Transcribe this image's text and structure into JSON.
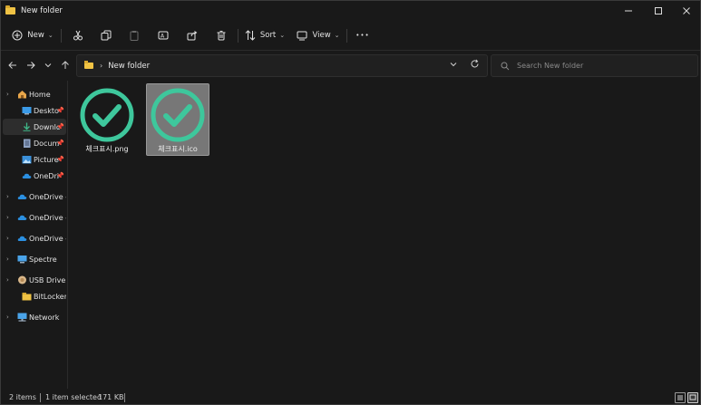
{
  "window": {
    "title": "New folder"
  },
  "commandbar": {
    "new_label": "New",
    "sort_label": "Sort",
    "view_label": "View",
    "more_label": "•••"
  },
  "address": {
    "crumb": "New folder",
    "search_placeholder": "Search New folder"
  },
  "sidebar": {
    "items": [
      {
        "label": "Home"
      },
      {
        "label": "Deskto"
      },
      {
        "label": "Downlc"
      },
      {
        "label": "Docum"
      },
      {
        "label": "Picture"
      },
      {
        "label": "OneDri"
      },
      {
        "label": "OneDrive -"
      },
      {
        "label": "OneDrive -"
      },
      {
        "label": "OneDrive -"
      },
      {
        "label": "Spectre"
      },
      {
        "label": "USB Drive (I"
      },
      {
        "label": "BitLocker"
      },
      {
        "label": "Network"
      }
    ]
  },
  "files": [
    {
      "name": "체크표시.png",
      "selected": false
    },
    {
      "name": "체크표시.ico",
      "selected": true
    }
  ],
  "status": {
    "count": "2 items",
    "selection": "1 item selected",
    "size": "171 KB"
  },
  "colors": {
    "check_green": "#3ec79c",
    "folder_yellow": "#f0c344",
    "onedrive_blue": "#2b8fe0"
  }
}
